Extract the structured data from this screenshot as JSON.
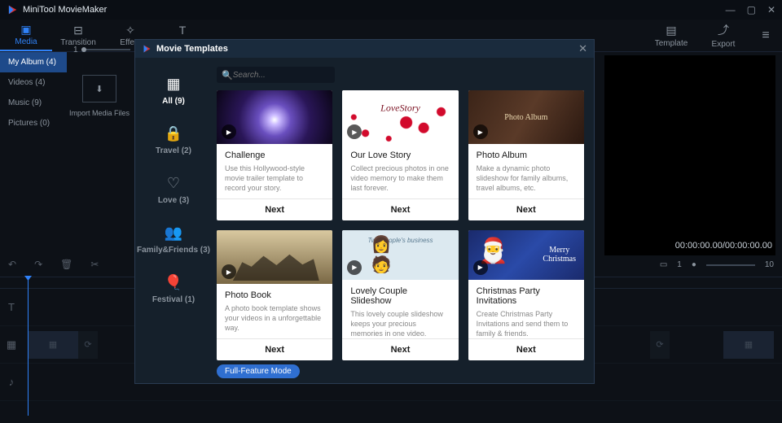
{
  "app": {
    "title": "MiniTool MovieMaker"
  },
  "toolbar": {
    "media": "Media",
    "transition": "Transition",
    "effect": "Effect",
    "text": "Text",
    "template": "Template",
    "export": "Export"
  },
  "sidebar": {
    "items": [
      {
        "label": "My Album",
        "count": 4,
        "text": "My Album  (4)"
      },
      {
        "label": "Videos",
        "count": 4,
        "text": "Videos  (4)"
      },
      {
        "label": "Music",
        "count": 9,
        "text": "Music  (9)"
      },
      {
        "label": "Pictures",
        "count": 0,
        "text": "Pictures  (0)"
      }
    ],
    "import_label": "Import Media Files",
    "zoom_value": "1"
  },
  "preview": {
    "timecode": "00:00:00.00/00:00:00.00",
    "scale_left": "1",
    "scale_right": "10"
  },
  "modal": {
    "title": "Movie Templates",
    "search_placeholder": "Search...",
    "categories": [
      {
        "name": "All",
        "count": 9,
        "text": "All  (9)"
      },
      {
        "name": "Travel",
        "count": 2,
        "text": "Travel  (2)"
      },
      {
        "name": "Love",
        "count": 3,
        "text": "Love  (3)"
      },
      {
        "name": "Family&Friends",
        "count": 3,
        "text": "Family&Friends  (3)"
      },
      {
        "name": "Festival",
        "count": 1,
        "text": "Festival  (1)"
      }
    ],
    "templates": [
      {
        "title": "Challenge",
        "desc": "Use this Hollywood-style movie trailer template to record your story.",
        "next": "Next"
      },
      {
        "title": "Our Love Story",
        "desc": "Collect precious photos in one video memory to make them last forever.",
        "next": "Next"
      },
      {
        "title": "Photo Album",
        "desc": "Make a dynamic photo slideshow for family albums, travel albums, etc.",
        "next": "Next"
      },
      {
        "title": "Photo Book",
        "desc": "A photo book template shows your videos in a unforgettable way.",
        "next": "Next"
      },
      {
        "title": "Lovely Couple Slideshow",
        "desc": "This lovely couple slideshow keeps your precious memories in one video.",
        "next": "Next"
      },
      {
        "title": "Christmas Party Invitations",
        "desc": "Create Christmas Party Invitations and send them to family & friends.",
        "next": "Next"
      }
    ],
    "full_feature": "Full-Feature Mode"
  }
}
